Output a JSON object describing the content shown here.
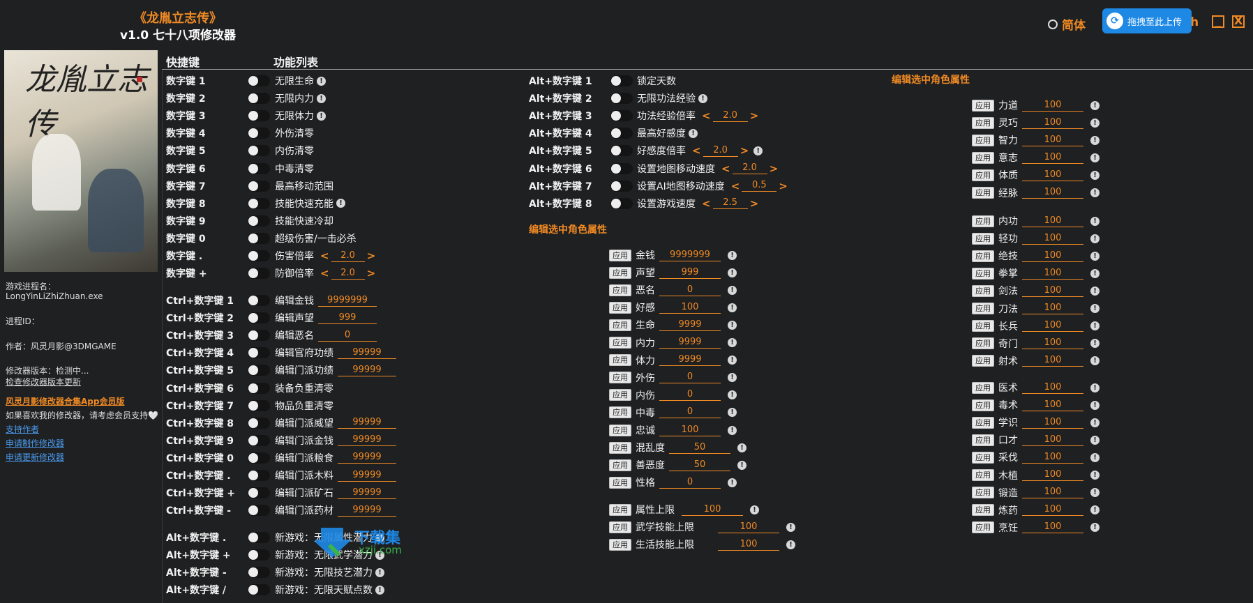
{
  "title": {
    "game": "《龙胤立志传》",
    "subtitle": "v1.0 七十八项修改器"
  },
  "lang": {
    "simplified": "简体",
    "english_suffix": "h"
  },
  "upload_label": "拖拽至此上传",
  "window": {
    "minimize": "_",
    "close": "X"
  },
  "cover_title": "龙胤立志传",
  "info": {
    "process_label": "游戏进程名：",
    "process_name": "LongYinLiZhiZhuan.exe",
    "pid_label": "进程ID：",
    "author": "作者：风灵月影@3DMGAME",
    "version": "修改器版本：检测中...",
    "check_update": "检查修改器版本更新",
    "app_vip": "风灵月影修改器合集App会员版",
    "support_text": "如果喜欢我的修改器，请考虑会员支持🤍",
    "support_author": "支持作者",
    "request_make": "申请制作修改器",
    "request_update": "申请更新修改器"
  },
  "headers": {
    "hotkey": "快捷键",
    "features": "功能列表"
  },
  "col1": [
    {
      "key": "数字键 1",
      "label": "无限生命",
      "bang": true
    },
    {
      "key": "数字键 2",
      "label": "无限内力",
      "bang": true
    },
    {
      "key": "数字键 3",
      "label": "无限体力",
      "bang": true
    },
    {
      "key": "数字键 4",
      "label": "外伤清零"
    },
    {
      "key": "数字键 5",
      "label": "内伤清零"
    },
    {
      "key": "数字键 6",
      "label": "中毒清零"
    },
    {
      "key": "数字键 7",
      "label": "最高移动范围"
    },
    {
      "key": "数字键 8",
      "label": "技能快速充能",
      "bang": true
    },
    {
      "key": "数字键 9",
      "label": "技能快速冷却"
    },
    {
      "key": "数字键 0",
      "label": "超级伤害/一击必杀"
    },
    {
      "key": "数字键 .",
      "label": "伤害倍率",
      "arrows": true,
      "value": "2.0"
    },
    {
      "key": "数字键 +",
      "label": "防御倍率",
      "arrows": true,
      "value": "2.0"
    }
  ],
  "col1b": [
    {
      "key": "Ctrl+数字键 1",
      "label": "编辑金钱",
      "value": "9999999"
    },
    {
      "key": "Ctrl+数字键 2",
      "label": "编辑声望",
      "value": "999"
    },
    {
      "key": "Ctrl+数字键 3",
      "label": "编辑恶名",
      "value": "0"
    },
    {
      "key": "Ctrl+数字键 4",
      "label": "编辑官府功绩",
      "value": "99999"
    },
    {
      "key": "Ctrl+数字键 5",
      "label": "编辑门派功绩",
      "value": "99999"
    },
    {
      "key": "Ctrl+数字键 6",
      "label": "装备负重清零"
    },
    {
      "key": "Ctrl+数字键 7",
      "label": "物品负重清零"
    },
    {
      "key": "Ctrl+数字键 8",
      "label": "编辑门派威望",
      "value": "99999"
    },
    {
      "key": "Ctrl+数字键 9",
      "label": "编辑门派金钱",
      "value": "99999"
    },
    {
      "key": "Ctrl+数字键 0",
      "label": "编辑门派粮食",
      "value": "99999"
    },
    {
      "key": "Ctrl+数字键 .",
      "label": "编辑门派木料",
      "value": "99999"
    },
    {
      "key": "Ctrl+数字键 +",
      "label": "编辑门派矿石",
      "value": "99999"
    },
    {
      "key": "Ctrl+数字键 -",
      "label": "编辑门派药材",
      "value": "99999"
    }
  ],
  "col1c": [
    {
      "key": "Alt+数字键 .",
      "label": "新游戏：无限属性潜力",
      "bang": true
    },
    {
      "key": "Alt+数字键 +",
      "label": "新游戏：无限武学潜力",
      "bang": true
    },
    {
      "key": "Alt+数字键 -",
      "label": "新游戏：无限技艺潜力",
      "bang": true
    },
    {
      "key": "Alt+数字键 /",
      "label": "新游戏：无限天赋点数",
      "bang": true
    }
  ],
  "col2": [
    {
      "key": "Alt+数字键 1",
      "label": "锁定天数"
    },
    {
      "key": "Alt+数字键 2",
      "label": "无限功法经验",
      "bang": true
    },
    {
      "key": "Alt+数字键 3",
      "label": "功法经验倍率",
      "arrows": true,
      "value": "2.0"
    },
    {
      "key": "Alt+数字键 4",
      "label": "最高好感度",
      "bang": true
    },
    {
      "key": "Alt+数字键 5",
      "label": "好感度倍率",
      "arrows": true,
      "value": "2.0",
      "bang": true
    },
    {
      "key": "Alt+数字键 6",
      "label": "设置地图移动速度",
      "arrows": true,
      "value": "2.0"
    },
    {
      "key": "Alt+数字键 7",
      "label": "设置AI地图移动速度",
      "arrows": true,
      "value": "0.5"
    },
    {
      "key": "Alt+数字键 8",
      "label": "设置游戏速度",
      "arrows": true,
      "value": "2.5"
    }
  ],
  "section_title": "编辑选中角色属性",
  "apply_label": "应用",
  "col2_attrs": [
    {
      "label": "金钱",
      "value": "9999999"
    },
    {
      "label": "声望",
      "value": "999"
    },
    {
      "label": "恶名",
      "value": "0"
    },
    {
      "label": "好感",
      "value": "100"
    },
    {
      "label": "生命",
      "value": "9999"
    },
    {
      "label": "内力",
      "value": "9999"
    },
    {
      "label": "体力",
      "value": "9999"
    },
    {
      "label": "外伤",
      "value": "0"
    },
    {
      "label": "内伤",
      "value": "0"
    },
    {
      "label": "中毒",
      "value": "0"
    },
    {
      "label": "忠诚",
      "value": "100"
    },
    {
      "label": "混乱度",
      "value": "50"
    },
    {
      "label": "善恶度",
      "value": "50"
    },
    {
      "label": "性格",
      "value": "0"
    }
  ],
  "col2_limits": [
    {
      "label": "属性上限",
      "value": "100"
    },
    {
      "label": "武学技能上限",
      "value": "100"
    },
    {
      "label": "生活技能上限",
      "value": "100"
    }
  ],
  "col3_group1": [
    {
      "label": "力道",
      "value": "100"
    },
    {
      "label": "灵巧",
      "value": "100"
    },
    {
      "label": "智力",
      "value": "100"
    },
    {
      "label": "意志",
      "value": "100"
    },
    {
      "label": "体质",
      "value": "100"
    },
    {
      "label": "经脉",
      "value": "100"
    }
  ],
  "col3_group2": [
    {
      "label": "内功",
      "value": "100"
    },
    {
      "label": "轻功",
      "value": "100"
    },
    {
      "label": "绝技",
      "value": "100"
    },
    {
      "label": "拳掌",
      "value": "100"
    },
    {
      "label": "剑法",
      "value": "100"
    },
    {
      "label": "刀法",
      "value": "100"
    },
    {
      "label": "长兵",
      "value": "100"
    },
    {
      "label": "奇门",
      "value": "100"
    },
    {
      "label": "射术",
      "value": "100"
    }
  ],
  "col3_group3": [
    {
      "label": "医术",
      "value": "100"
    },
    {
      "label": "毒术",
      "value": "100"
    },
    {
      "label": "学识",
      "value": "100"
    },
    {
      "label": "口才",
      "value": "100"
    },
    {
      "label": "采伐",
      "value": "100"
    },
    {
      "label": "木植",
      "value": "100"
    },
    {
      "label": "锻造",
      "value": "100"
    },
    {
      "label": "炼药",
      "value": "100"
    },
    {
      "label": "烹饪",
      "value": "100"
    }
  ],
  "watermark": {
    "brand": "下载集",
    "site": "xzji.com"
  },
  "colors": {
    "accent": "#f08a24",
    "bg": "#1f2022",
    "upload": "#1e88e5",
    "link": "#4a9cf0"
  }
}
